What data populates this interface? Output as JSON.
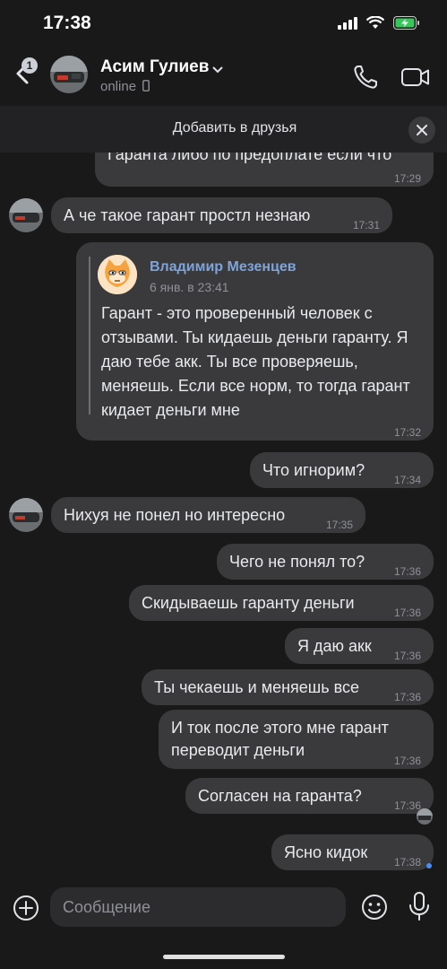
{
  "status_bar": {
    "time": "17:38"
  },
  "header": {
    "back_badge": "1",
    "name": "Асим Гулиев",
    "status": "online"
  },
  "banner": {
    "text": "Добавить в друзья"
  },
  "messages": {
    "m0": {
      "text": "Гаранта либо по предоплате если что",
      "time": "17:29"
    },
    "m1": {
      "text": "А че такое гарант простл незнаю",
      "time": "17:31"
    },
    "m2": {
      "quote_author": "Владимир Мезенцев",
      "quote_date": "6 янв. в 23:41",
      "quote_text": "Гарант - это проверенный человек с отзывами. Ты кидаешь деньги гаранту. Я даю тебе акк. Ты все проверяешь, меняешь. Если все норм, то тогда гарант кидает деньги мне",
      "time": "17:32"
    },
    "m3": {
      "text": "Что игнорим?",
      "time": "17:34"
    },
    "m4": {
      "text": "Нихуя не понел но интересно",
      "time": "17:35"
    },
    "m5": {
      "text": "Чего не понял то?",
      "time": "17:36"
    },
    "m6": {
      "text": "Скидываешь гаранту деньги",
      "time": "17:36"
    },
    "m7": {
      "text": "Я даю акк",
      "time": "17:36"
    },
    "m8": {
      "text": "Ты чекаешь и меняешь все",
      "time": "17:36"
    },
    "m9": {
      "text_line1": "И ток после этого мне гарант",
      "text_line2": "переводит деньги",
      "time": "17:36"
    },
    "m10": {
      "text": "Согласен на гаранта?",
      "time": "17:36"
    },
    "m11": {
      "text": "Ясно кидок",
      "time": "17:38"
    }
  },
  "composer": {
    "placeholder": "Сообщение"
  },
  "colors": {
    "background": "#19191a",
    "bubble": "#3a3a3c",
    "accent_blue": "#7ea4d9",
    "unread_dot": "#4a8cf7"
  },
  "icons": [
    "back-icon",
    "chevron-down-icon",
    "phone-icon",
    "video-icon",
    "close-icon",
    "plus-icon",
    "smile-icon",
    "mic-icon"
  ]
}
